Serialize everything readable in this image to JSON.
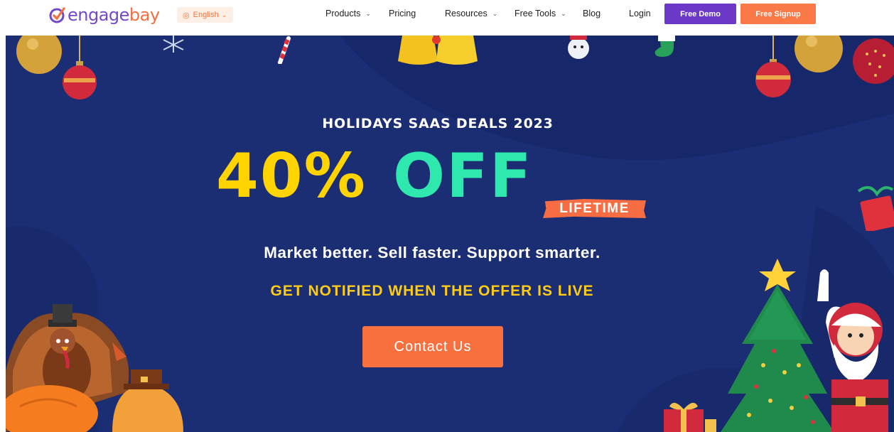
{
  "nav": {
    "logo_prefix": "engage",
    "logo_suffix": "bay",
    "language": "English",
    "items": [
      {
        "label": "Products",
        "has_dropdown": true
      },
      {
        "label": "Pricing",
        "has_dropdown": false
      },
      {
        "label": "Resources",
        "has_dropdown": true
      },
      {
        "label": "Free Tools",
        "has_dropdown": true
      },
      {
        "label": "Blog",
        "has_dropdown": false
      },
      {
        "label": "Login",
        "has_dropdown": false
      }
    ],
    "demo_label": "Free Demo",
    "signup_label": "Free Signup"
  },
  "hero": {
    "kicker": "HOLIDAYS SAAS DEALS 2023",
    "discount": "40%",
    "off": "OFF",
    "badge": "LIFETIME",
    "tagline": "Market better. Sell faster. Support smarter.",
    "notify": "GET NOTIFIED WHEN THE OFFER IS LIVE",
    "cta_label": "Contact Us"
  },
  "colors": {
    "brand_purple": "#6a39c8",
    "brand_orange": "#f97a47",
    "hero_bg": "#1b2e73",
    "discount_yellow": "#ffd400",
    "off_green": "#2ee8ad"
  },
  "icons": [
    "logo-mark-icon",
    "globe-icon",
    "chevron-down-icon",
    "ornament-icon",
    "bell-icon",
    "snowman-icon",
    "stocking-icon",
    "candy-cane-icon",
    "snowflake-icon",
    "christmas-tree-icon",
    "santa-icon",
    "turkey-icon",
    "pumpkin-icon",
    "gift-icon",
    "star-icon"
  ]
}
